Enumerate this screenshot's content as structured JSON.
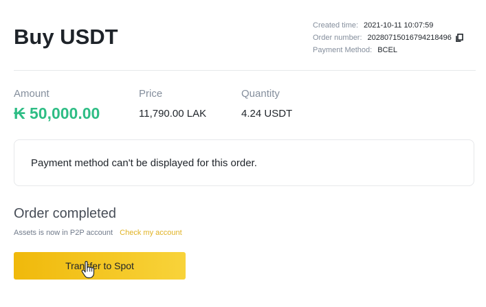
{
  "header": {
    "title": "Buy USDT"
  },
  "order_meta": {
    "created_label": "Created time:",
    "created_value": "2021-10-11 10:07:59",
    "order_label": "Order number:",
    "order_value": "20280715016794218496",
    "payment_label": "Payment Method:",
    "payment_value": "BCEL",
    "copy_icon": "copy-icon"
  },
  "stats": {
    "amount_label": "Amount",
    "amount_value": "₭ 50,000.00",
    "price_label": "Price",
    "price_value": "11,790.00 LAK",
    "quantity_label": "Quantity",
    "quantity_value": "4.24 USDT"
  },
  "notice": {
    "text": "Payment method can't be displayed for this order."
  },
  "status": {
    "title": "Order completed",
    "subtitle": "Assets is now in P2P account",
    "link": "Check my account"
  },
  "actions": {
    "transfer_label": "Transfer to Spot"
  },
  "colors": {
    "amount_green": "#2ebd85",
    "brand_yellow": "#f0b90b",
    "link_gold": "#e0b223"
  }
}
